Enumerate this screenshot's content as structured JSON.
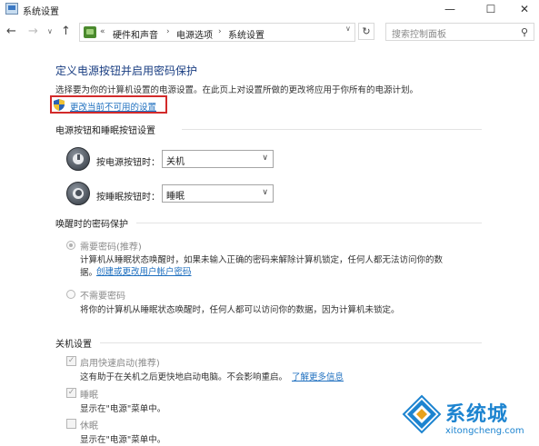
{
  "window": {
    "title": "系统设置",
    "minimize": "—",
    "maximize": "☐",
    "close": "✕"
  },
  "nav": {
    "back": "←",
    "forward": "→",
    "history": "∨",
    "up": "↑",
    "overflow": "«",
    "breadcrumb": [
      "硬件和声音",
      "电源选项",
      "系统设置"
    ],
    "separator": "›",
    "dropdown": "∨",
    "refresh": "↻",
    "search_placeholder": "搜索控制面板",
    "search_icon": "⚲"
  },
  "page": {
    "title": "定义电源按钮并启用密码保护",
    "description": "选择要为你的计算机设置的电源设置。在此页上对设置所做的更改将应用于你所有的电源计划。",
    "change_link": "更改当前不可用的设置"
  },
  "power_section": {
    "heading": "电源按钮和睡眠按钮设置",
    "power_button_label": "按电源按钮时：",
    "power_button_value": "关机",
    "sleep_button_label": "按睡眠按钮时：",
    "sleep_button_value": "睡眠",
    "arrow": "∨"
  },
  "wake_section": {
    "heading": "唤醒时的密码保护",
    "require_label": "需要密码(推荐)",
    "require_desc_1": "计算机从睡眠状态唤醒时，如果未输入正确的密码来解除计算机锁定，任何人都无法访问你的数",
    "require_desc_2": "据。",
    "require_link": "创建或更改用户帐户密码",
    "norequire_label": "不需要密码",
    "norequire_desc": "将你的计算机从睡眠状态唤醒时，任何人都可以访问你的数据，因为计算机未锁定。"
  },
  "shutdown_section": {
    "heading": "关机设置",
    "fast_startup_label": "启用快速启动(推荐)",
    "fast_startup_desc": "这有助于在关机之后更快地启动电脑。不会影响重启。",
    "learn_more": "了解更多信息",
    "sleep_label": "睡眠",
    "sleep_desc": "显示在\"电源\"菜单中。",
    "hibernate_label": "休眠",
    "hibernate_desc": "显示在\"电源\"菜单中。",
    "check_mark": "✓"
  },
  "watermark": {
    "brand": "系统城",
    "url": "xitongcheng.com"
  },
  "colors": {
    "title_blue": "#1a3e82",
    "link_blue": "#1e6fbf",
    "highlight_red": "#d22a2a"
  }
}
